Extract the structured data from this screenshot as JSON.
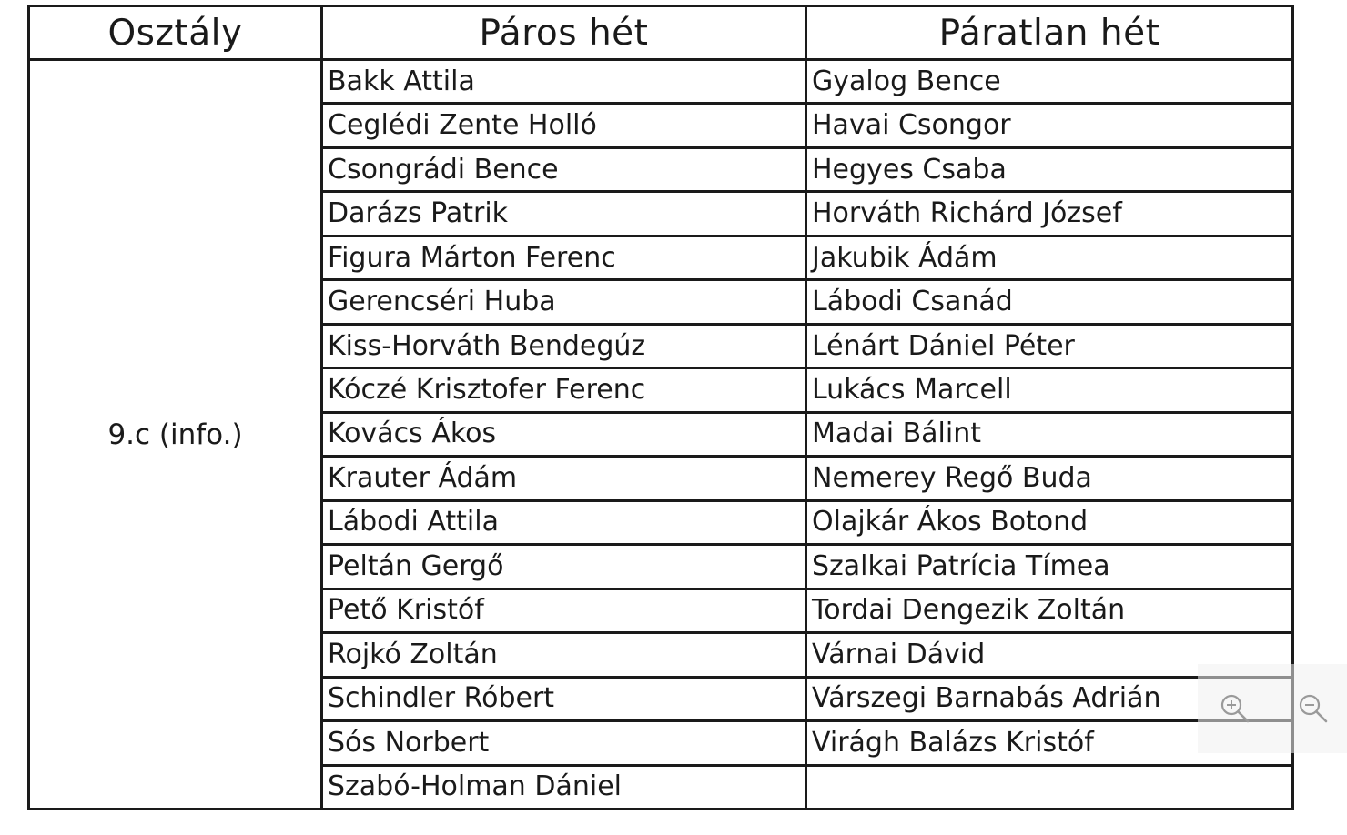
{
  "table": {
    "headers": [
      "Osztály",
      "Páros hét",
      "Páratlan hét"
    ],
    "class_label": "9.c (info.)",
    "rows": [
      [
        "Bakk Attila",
        "Gyalog Bence"
      ],
      [
        "Ceglédi Zente Holló",
        "Havai Csongor"
      ],
      [
        "Csongrádi Bence",
        "Hegyes Csaba"
      ],
      [
        "Darázs Patrik",
        "Horváth Richárd József"
      ],
      [
        "Figura Márton Ferenc",
        "Jakubik Ádám"
      ],
      [
        "Gerencséri Huba",
        "Lábodi Csanád"
      ],
      [
        "Kiss-Horváth Bendegúz",
        "Lénárt Dániel Péter"
      ],
      [
        "Kóczé Krisztofer Ferenc",
        "Lukács Marcell"
      ],
      [
        "Kovács Ákos",
        "Madai Bálint"
      ],
      [
        "Krauter Ádám",
        "Nemerey Regő Buda"
      ],
      [
        "Lábodi Attila",
        "Olajkár Ákos Botond"
      ],
      [
        "Peltán Gergő",
        "Szalkai Patrícia Tímea"
      ],
      [
        "Pető Kristóf",
        "Tordai Dengezik Zoltán"
      ],
      [
        "Rojkó Zoltán",
        "Várnai Dávid"
      ],
      [
        "Schindler Róbert",
        "Várszegi Barnabás Adrián"
      ],
      [
        "Sós Norbert",
        "Virágh Balázs Kristóf"
      ],
      [
        "Szabó-Holman Dániel",
        ""
      ]
    ]
  },
  "zoom_controls": {
    "zoom_in_icon": "zoom-in-icon",
    "zoom_out_icon": "zoom-out-icon"
  }
}
